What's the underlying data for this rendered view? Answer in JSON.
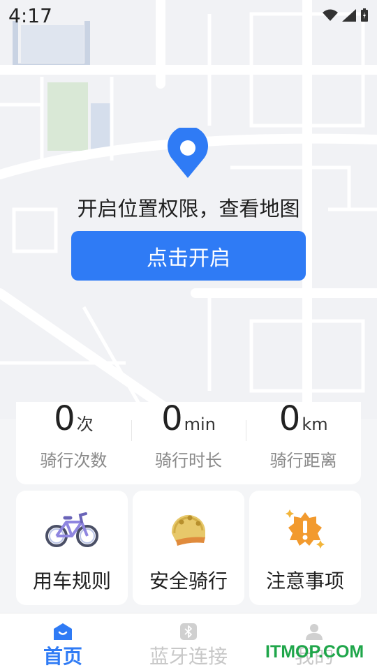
{
  "status_bar": {
    "time": "4:17"
  },
  "permission": {
    "message": "开启位置权限，查看地图",
    "button_label": "点击开启"
  },
  "stats": [
    {
      "value": "0",
      "unit": "次",
      "label": "骑行次数"
    },
    {
      "value": "0",
      "unit": "min",
      "label": "骑行时长"
    },
    {
      "value": "0",
      "unit": "km",
      "label": "骑行距离"
    }
  ],
  "cards": [
    {
      "label": "用车规则",
      "icon": "bicycle-icon"
    },
    {
      "label": "安全骑行",
      "icon": "helmet-icon"
    },
    {
      "label": "注意事项",
      "icon": "warning-icon"
    }
  ],
  "tabs": [
    {
      "label": "首页",
      "icon": "home-icon",
      "active": true
    },
    {
      "label": "蓝牙连接",
      "icon": "bluetooth-icon",
      "active": false
    },
    {
      "label": "我的",
      "icon": "user-icon",
      "active": false
    }
  ],
  "watermark": "ITMOP.COM",
  "colors": {
    "accent": "#2f7bf5",
    "watermark": "#1fa64a"
  }
}
